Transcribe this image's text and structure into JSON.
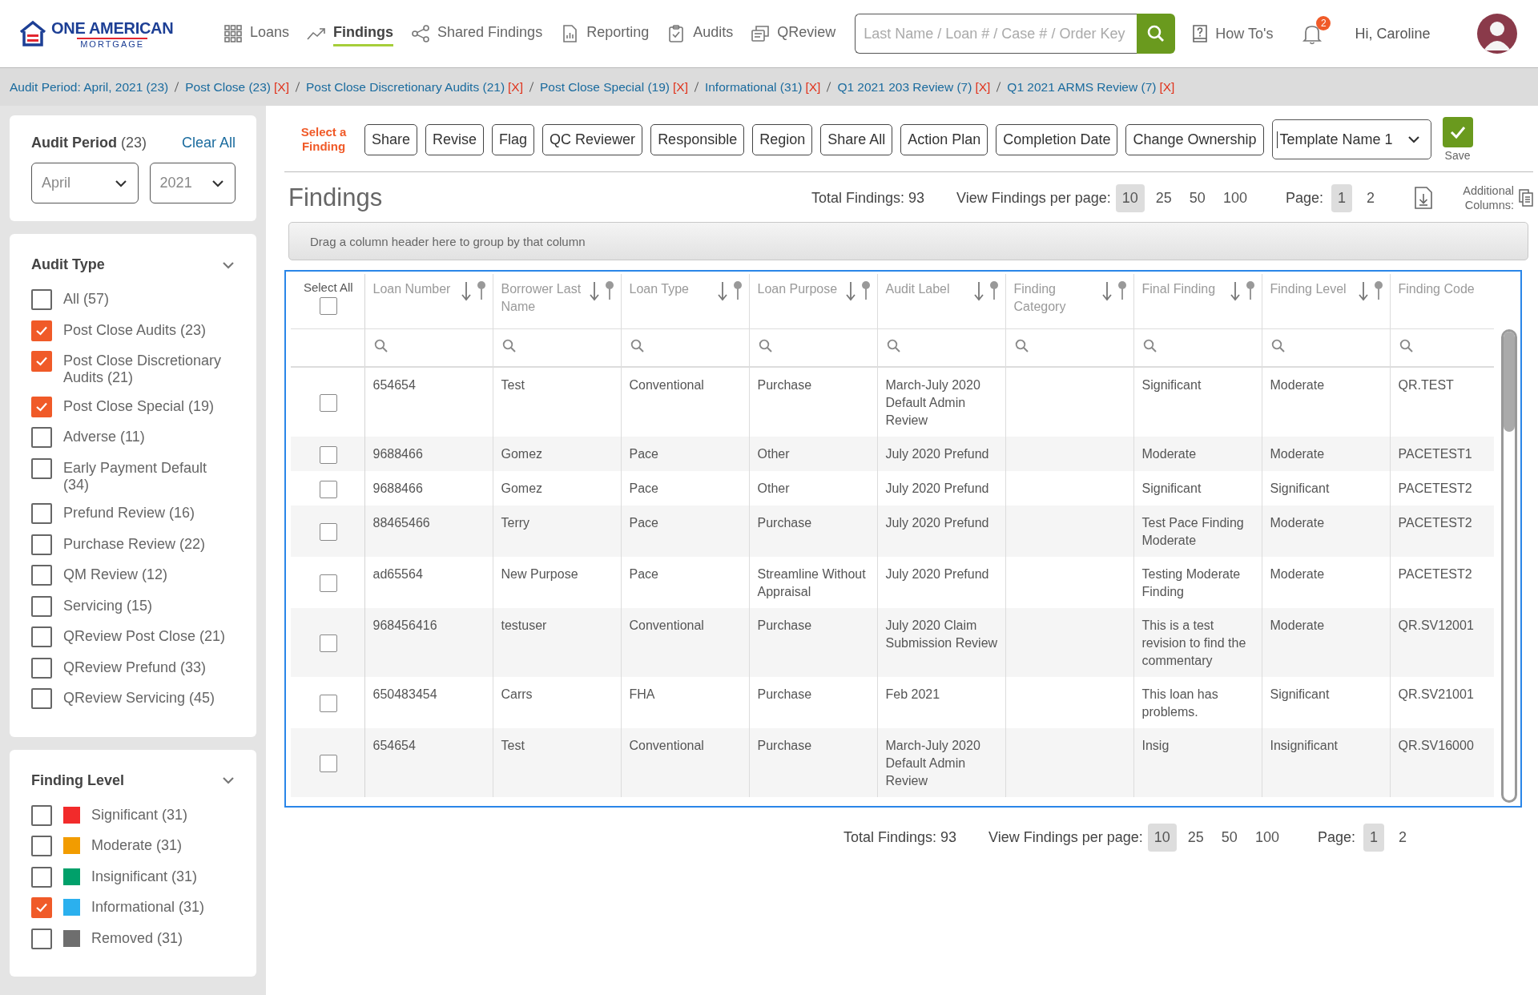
{
  "header": {
    "brand": {
      "name": "ONE AMERICAN",
      "subtitle": "MORTGAGE"
    },
    "nav": [
      {
        "label": "Loans",
        "selected": false
      },
      {
        "label": "Findings",
        "selected": true
      },
      {
        "label": "Shared Findings",
        "selected": false
      },
      {
        "label": "Reporting",
        "selected": false
      },
      {
        "label": "Audits",
        "selected": false
      },
      {
        "label": "QReview",
        "selected": false
      }
    ],
    "search": {
      "placeholder": "Last Name / Loan # / Case # / Order Key"
    },
    "help": "How To's",
    "notifications": "2",
    "greeting": "Hi, Caroline"
  },
  "breadcrumbs": [
    {
      "label": "Audit Period: April, 2021 (23)"
    },
    {
      "label": "Post Close (23)",
      "remove": "[X]"
    },
    {
      "label": "Post Close Discretionary Audits (21)",
      "remove": "[X]"
    },
    {
      "label": "Post Close Special (19)",
      "remove": "[X]"
    },
    {
      "label": "Informational (31)",
      "remove": "[X]"
    },
    {
      "label": "Q1 2021 203 Review (7)",
      "remove": "[X]"
    },
    {
      "label": "Q1 2021 ARMS Review (7)",
      "remove": "[X]"
    }
  ],
  "sidebar": {
    "audit_period": {
      "title": "**Audit Period** (23)",
      "clear": "Clear All",
      "month": "April",
      "year": "2021"
    },
    "audit_type": {
      "title": "Audit Type",
      "items": [
        {
          "label": "All (57)",
          "checked": false
        },
        {
          "label": "Post Close Audits (23)",
          "checked": true
        },
        {
          "label": "Post Close Discretionary Audits (21)",
          "checked": true
        },
        {
          "label": "Post Close Special (19)",
          "checked": true
        },
        {
          "label": "Adverse (11)",
          "checked": false
        },
        {
          "label": "Early Payment Default (34)",
          "checked": false
        },
        {
          "label": "Prefund Review (16)",
          "checked": false
        },
        {
          "label": "Purchase Review (22)",
          "checked": false
        },
        {
          "label": "QM Review (12)",
          "checked": false
        },
        {
          "label": "Servicing (15)",
          "checked": false
        },
        {
          "label": "QReview Post Close (21)",
          "checked": false
        },
        {
          "label": "QReview Prefund (33)",
          "checked": false
        },
        {
          "label": "QReview Servicing (45)",
          "checked": false
        }
      ]
    },
    "finding_level": {
      "title": "Finding Level",
      "items": [
        {
          "label": "Significant (31)",
          "color": "#f22b2b",
          "checked": false
        },
        {
          "label": "Moderate (31)",
          "color": "#f29c00",
          "checked": false
        },
        {
          "label": "Insignificant (31)",
          "color": "#00a06a",
          "checked": false
        },
        {
          "label": "Informational (31)",
          "color": "#2bb0ee",
          "checked": true
        },
        {
          "label": "Removed (31)",
          "color": "#6e6e6e",
          "checked": false
        }
      ]
    }
  },
  "toolbar": {
    "hint": "Select a Finding",
    "buttons": [
      "Share",
      "Revise",
      "Flag",
      "QC Reviewer",
      "Responsible",
      "Region",
      "Share All",
      "Action Plan",
      "Completion Date",
      "Change Ownership"
    ],
    "template": "Template Name 1",
    "save": "Save"
  },
  "findings": {
    "title": "Findings",
    "total": "Total Findings: 93",
    "per_page_label": "View Findings per page:",
    "per_page": [
      {
        "label": "10",
        "selected": true
      },
      {
        "label": "25",
        "selected": false
      },
      {
        "label": "50",
        "selected": false
      },
      {
        "label": "100",
        "selected": false
      }
    ],
    "page_label": "Page:",
    "pages": [
      {
        "label": "1",
        "selected": true
      },
      {
        "label": "2",
        "selected": false
      }
    ],
    "additional_columns": "Additional Columns:",
    "group_hint": "Drag a column header here to group by that column"
  },
  "table": {
    "select_all": {
      "label": "Select All",
      "checked": false
    },
    "columns": [
      "Loan Number",
      "Borrower Last Name",
      "Loan Type",
      "Loan Purpose",
      "Audit Label",
      "Finding Category",
      "Final Finding",
      "Finding Level",
      "Finding Code"
    ],
    "rows": [
      {
        "checked": false,
        "loan_number": "654654",
        "borrower": "Test",
        "loan_type": "Conventional",
        "loan_purpose": "Purchase",
        "audit_label": "March-July 2020 Default Admin Review",
        "final_finding": "Significant",
        "finding_level": "Moderate",
        "finding_code": "QR.TEST"
      },
      {
        "checked": false,
        "loan_number": "9688466",
        "borrower": "Gomez",
        "loan_type": "Pace",
        "loan_purpose": "Other",
        "audit_label": "July 2020 Prefund",
        "final_finding": "Moderate",
        "finding_level": "Moderate",
        "finding_code": "PACETEST1"
      },
      {
        "checked": false,
        "loan_number": "9688466",
        "borrower": "Gomez",
        "loan_type": "Pace",
        "loan_purpose": "Other",
        "audit_label": "July 2020 Prefund",
        "final_finding": "Significant",
        "finding_level": "Significant",
        "finding_code": "PACETEST2"
      },
      {
        "checked": false,
        "loan_number": "88465466",
        "borrower": "Terry",
        "loan_type": "Pace",
        "loan_purpose": "Purchase",
        "audit_label": "July 2020 Prefund",
        "final_finding": "Test Pace Finding Moderate",
        "finding_level": "Moderate",
        "finding_code": "PACETEST2"
      },
      {
        "checked": false,
        "loan_number": "ad65564",
        "borrower": "New Purpose",
        "loan_type": "Pace",
        "loan_purpose": "Streamline Without Appraisal",
        "audit_label": "July 2020 Prefund",
        "final_finding": "Testing Moderate Finding",
        "finding_level": "Moderate",
        "finding_code": "PACETEST2"
      },
      {
        "checked": false,
        "loan_number": "968456416",
        "borrower": "testuser",
        "loan_type": "Conventional",
        "loan_purpose": "Purchase",
        "audit_label": "July 2020 Claim Submission Review",
        "final_finding": "This is a test revision to find the commentary",
        "finding_level": "Moderate",
        "finding_code": "QR.SV12001"
      },
      {
        "checked": false,
        "loan_number": "650483454",
        "borrower": "Carrs",
        "loan_type": "FHA",
        "loan_purpose": "Purchase",
        "audit_label": "Feb 2021",
        "final_finding": "This loan has problems.",
        "finding_level": "Significant",
        "finding_code": "QR.SV21001"
      },
      {
        "checked": false,
        "loan_number": "654654",
        "borrower": "Test",
        "loan_type": "Conventional",
        "loan_purpose": "Purchase",
        "audit_label": "March-July 2020 Default Admin Review",
        "final_finding": "Insig",
        "finding_level": "Insignificant",
        "finding_code": "QR.SV16000"
      }
    ]
  },
  "footer": {
    "total": "Total Findings: 93",
    "per_page_label": "View Findings per page:",
    "per_page": [
      {
        "label": "10",
        "selected": true
      },
      {
        "label": "25",
        "selected": false
      },
      {
        "label": "50",
        "selected": false
      },
      {
        "label": "100",
        "selected": false
      }
    ],
    "page_label": "Page:",
    "pages": [
      {
        "label": "1",
        "selected": true
      },
      {
        "label": "2",
        "selected": false
      }
    ]
  }
}
